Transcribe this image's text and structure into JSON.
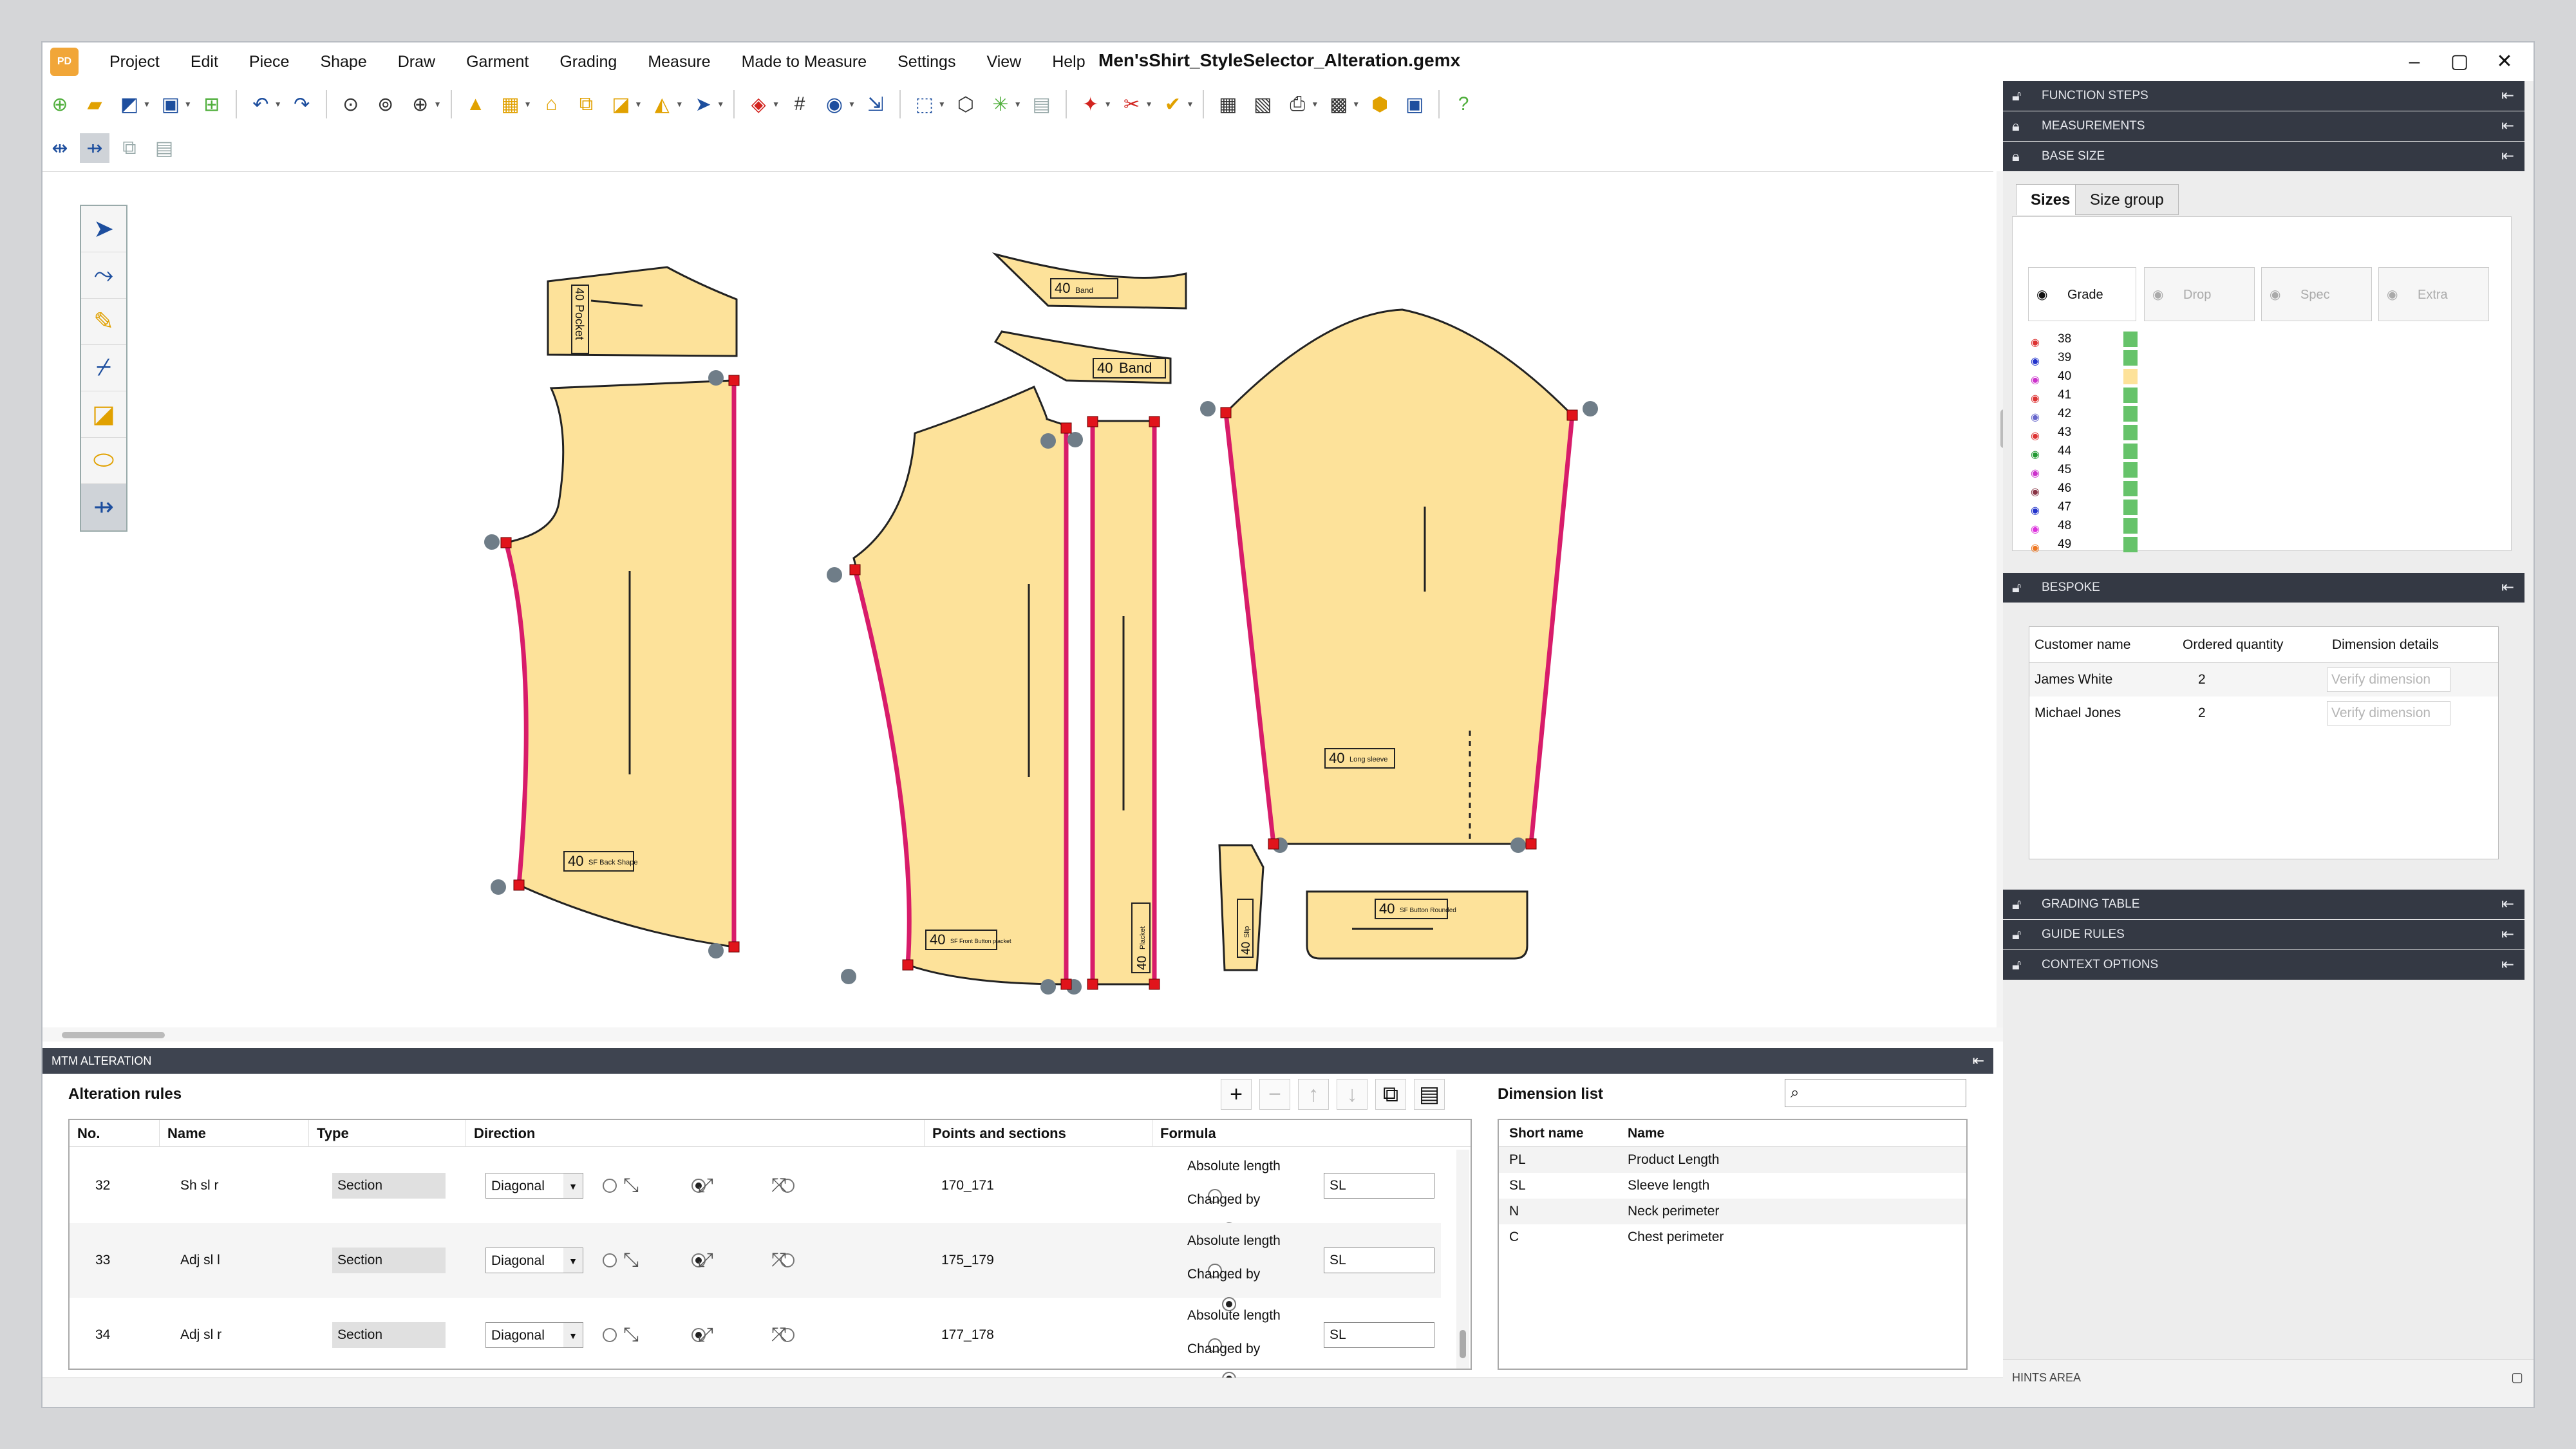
{
  "app": {
    "logo": "PD",
    "title": "Men'sShirt_StyleSelector_Alteration.gemx",
    "window_controls": [
      "–",
      "▢",
      "✕"
    ]
  },
  "menu": [
    "Project",
    "Edit",
    "Piece",
    "Shape",
    "Draw",
    "Garment",
    "Grading",
    "Measure",
    "Made to Measure",
    "Settings",
    "View",
    "Help"
  ],
  "pieces": {
    "yoke": {
      "size": "40",
      "label": "Pocket"
    },
    "collar": {
      "size": "40",
      "label": "Band"
    },
    "collar_stand": {
      "size": "40",
      "label": "Band"
    },
    "back": {
      "size": "40",
      "label": "SF Back Shape"
    },
    "front": {
      "size": "40",
      "label": "SF Front Button placket"
    },
    "placket": {
      "size": "40",
      "label": "Placket"
    },
    "sleeve": {
      "size": "40",
      "label": "Long sleeve"
    },
    "cuff": {
      "size": "40",
      "label": "SF Button Rounded"
    },
    "gusset": {
      "size": "40",
      "label": "Slip"
    }
  },
  "mtm": {
    "header": "MTM ALTERATION"
  },
  "alteration": {
    "title": "Alteration rules",
    "columns": [
      "No.",
      "Name",
      "Type",
      "Direction",
      "Points and sections",
      "Formula"
    ],
    "rows": [
      {
        "no": "32",
        "name": "Sh sl r",
        "type": "Section",
        "direction": "Diagonal",
        "points": "170_171",
        "formula_opt1": "Absolute length",
        "formula_opt2": "Changed by",
        "formula_value": "SL"
      },
      {
        "no": "33",
        "name": "Adj sl l",
        "type": "Section",
        "direction": "Diagonal",
        "points": "175_179",
        "formula_opt1": "Absolute length",
        "formula_opt2": "Changed by",
        "formula_value": "SL"
      },
      {
        "no": "34",
        "name": "Adj sl r",
        "type": "Section",
        "direction": "Diagonal",
        "points": "177_178",
        "formula_opt1": "Absolute length",
        "formula_opt2": "Changed by",
        "formula_value": "SL"
      }
    ]
  },
  "dimension": {
    "title": "Dimension list",
    "search_value": "",
    "columns": [
      "Short name",
      "Name"
    ],
    "rows": [
      {
        "short": "PL",
        "name": "Product Length"
      },
      {
        "short": "SL",
        "name": "Sleeve length"
      },
      {
        "short": "N",
        "name": "Neck perimeter"
      },
      {
        "short": "C",
        "name": "Chest perimeter"
      }
    ]
  },
  "right_panel": {
    "function_steps": "FUNCTION STEPS",
    "measurements": "MEASUREMENTS",
    "base_size": "BASE SIZE",
    "tabs": [
      "Sizes",
      "Size group"
    ],
    "size_columns": [
      "Grade",
      "Drop",
      "Spec",
      "Extra"
    ],
    "sizes": [
      {
        "label": "38",
        "color": "#d33"
      },
      {
        "label": "39",
        "color": "#23c"
      },
      {
        "label": "40",
        "color": "#c3c"
      },
      {
        "label": "41",
        "color": "#d33"
      },
      {
        "label": "42",
        "color": "#66c"
      },
      {
        "label": "43",
        "color": "#d33"
      },
      {
        "label": "44",
        "color": "#293"
      },
      {
        "label": "45",
        "color": "#c3c"
      },
      {
        "label": "46",
        "color": "#834"
      },
      {
        "label": "47",
        "color": "#23c"
      },
      {
        "label": "48",
        "color": "#d3d"
      },
      {
        "label": "49",
        "color": "#e72"
      }
    ],
    "base_size_index": 2,
    "bespoke": "BESPOKE",
    "bespoke_columns": [
      "Customer name",
      "Ordered quantity",
      "Dimension details"
    ],
    "bespoke_rows": [
      {
        "customer": "James White",
        "qty": "2",
        "action": "Verify dimension"
      },
      {
        "customer": "Michael Jones",
        "qty": "2",
        "action": "Verify dimension"
      }
    ],
    "grading_table": "GRADING TABLE",
    "guide_rules": "GUIDE RULES",
    "context_options": "CONTEXT OPTIONS",
    "hints": "HINTS AREA"
  },
  "colors": {
    "piece_fill": "#fde29a",
    "piece_stroke": "#222",
    "highlight": "#d81c6a",
    "point": "#6f7d88",
    "anchor": "#e1141b",
    "panel_header": "#343944",
    "accent_green": "#66c36a",
    "base_size": "#fde29a"
  }
}
